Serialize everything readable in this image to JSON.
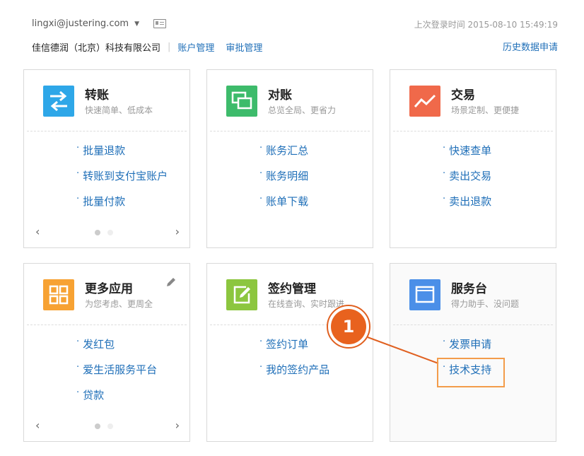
{
  "header": {
    "user_email": "lingxi@justering.com",
    "company": "佳信德润（北京）科技有限公司",
    "links": [
      "账户管理",
      "审批管理"
    ],
    "last_login": "上次登录时间 2015-08-10 15:49:19",
    "history_request": "历史数据申请"
  },
  "cards": [
    {
      "title": "转账",
      "subtitle": "快速简单、低成本",
      "icon": "transfer-icon",
      "color": "#2ea7e8",
      "links": [
        "批量退款",
        "转账到支付宝账户",
        "批量付款"
      ]
    },
    {
      "title": "对账",
      "subtitle": "总览全局、更省力",
      "icon": "reconcile-icon",
      "color": "#3dbb6b",
      "links": [
        "账务汇总",
        "账务明细",
        "账单下载"
      ]
    },
    {
      "title": "交易",
      "subtitle": "场景定制、更便捷",
      "icon": "trade-chart-icon",
      "color": "#f0694a",
      "links": [
        "快速查单",
        "卖出交易",
        "卖出退款"
      ]
    },
    {
      "title": "更多应用",
      "subtitle": "为您考虑、更周全",
      "icon": "apps-grid-icon",
      "color": "#f7a233",
      "links": [
        "发红包",
        "爱生活服务平台",
        "贷款"
      ]
    },
    {
      "title": "签约管理",
      "subtitle": "在线查询、实时跟进",
      "icon": "sign-edit-icon",
      "color": "#8cc63f",
      "links": [
        "签约订单",
        "我的签约产品"
      ]
    },
    {
      "title": "服务台",
      "subtitle": "得力助手、没问题",
      "icon": "service-window-icon",
      "color": "#4b8fe8",
      "links": [
        "发票申请",
        "技术支持"
      ]
    }
  ],
  "callout": {
    "number": "1"
  }
}
